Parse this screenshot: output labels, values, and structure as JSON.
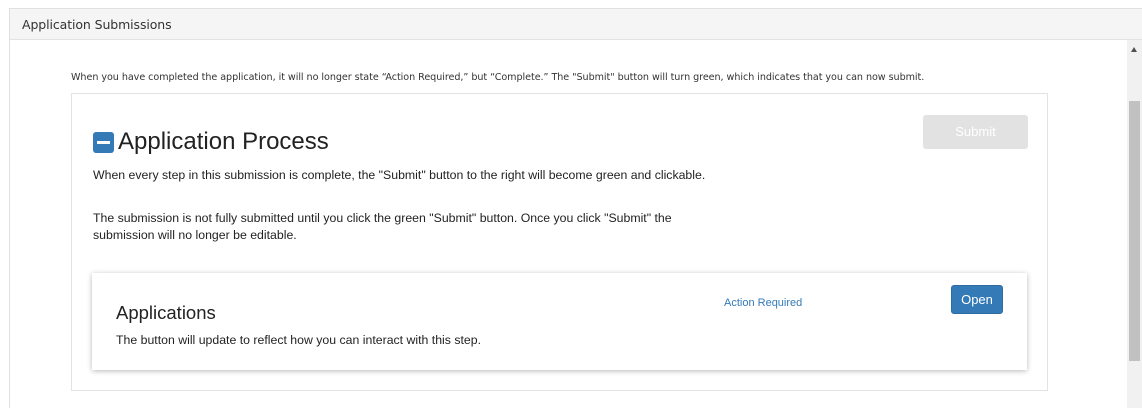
{
  "panel": {
    "title": "Application Submissions"
  },
  "instruction": "When you have completed the application, it will no longer state “Action Required,” but “Complete.” The \"Submit\" button will turn green, which indicates that you can now submit.",
  "process": {
    "title": "Application Process",
    "description_1": "When every step in this submission is complete, the \"Submit\" button to the right will become green and clickable.",
    "description_2": "The submission is not fully submitted until you click the green \"Submit\" button. Once you click \"Submit\" the submission will no longer be editable.",
    "submit_label": "Submit",
    "submit_enabled": false
  },
  "steps": [
    {
      "title": "Applications",
      "description": "The button will update to reflect how you can interact with this step.",
      "status": "Action Required",
      "action_label": "Open"
    }
  ],
  "colors": {
    "primary": "#337ab7",
    "disabled": "#e2e2e2",
    "header_bg": "#f5f5f5"
  },
  "icons": {
    "collapse": "minus-square-icon",
    "scroll_up": "scroll-up-arrow-icon"
  }
}
